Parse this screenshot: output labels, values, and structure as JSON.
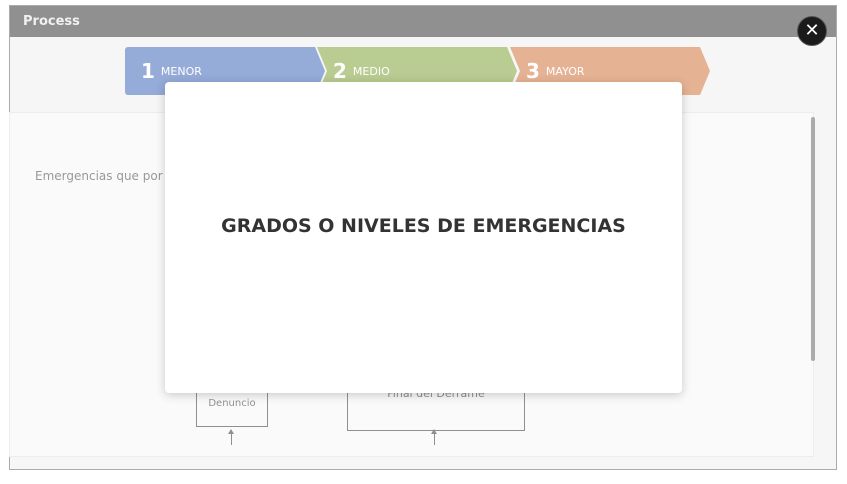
{
  "window": {
    "title": "Process"
  },
  "steps": [
    {
      "number": "1",
      "label": "MENOR",
      "color": "#3f67b8"
    },
    {
      "number": "2",
      "label": "MEDIO",
      "color": "#80a23a"
    },
    {
      "number": "3",
      "label": "MAYOR",
      "color": "#d1743c"
    }
  ],
  "content": {
    "intro": "Emergencias que por",
    "flowchart": {
      "box1": "Denuncio",
      "box2": "Final del Derrame"
    }
  },
  "modal": {
    "heading": "GRADOS O NIVELES DE EMERGENCIAS"
  },
  "close": {
    "icon": "close-icon",
    "glyph": "✕"
  }
}
